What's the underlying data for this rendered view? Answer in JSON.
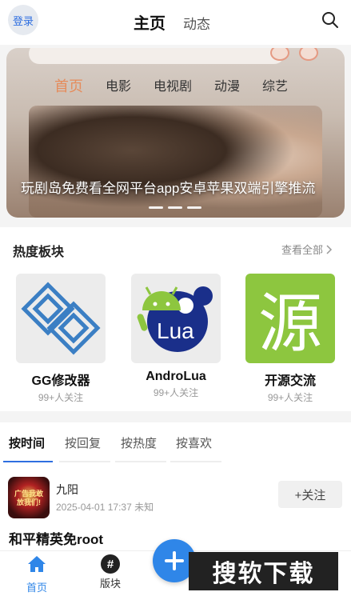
{
  "header": {
    "login_label": "登录",
    "tab_home": "主页",
    "tab_dynamic": "动态"
  },
  "banner": {
    "nav": [
      "首页",
      "电影",
      "电视剧",
      "动漫",
      "综艺"
    ],
    "title": "玩剧岛免费看全网平台app安卓苹果双端引擎推流"
  },
  "hot": {
    "title": "热度板块",
    "see_all": "查看全部",
    "boards": [
      {
        "name": "GG修改器",
        "follow": "99+人关注"
      },
      {
        "name": "AndroLua",
        "follow": "99+人关注"
      },
      {
        "name": "开源交流",
        "follow": "99+人关注"
      }
    ],
    "lua_text": "Lua",
    "source_char": "源"
  },
  "feed": {
    "tabs": [
      "按时间",
      "按回复",
      "按热度",
      "按喜欢"
    ],
    "post": {
      "avatar_text": "广告我敢放我们!",
      "user": "九阳",
      "meta": "2025-04-01 17:37 未知",
      "follow_label": "+关注",
      "title": "和平精英免root"
    }
  },
  "bottom_nav": {
    "home": "首页",
    "board": "版块",
    "board_icon_glyph": "#"
  },
  "watermark": "搜软下载",
  "colors": {
    "accent": "#2f86e8",
    "link": "#2f6fe0",
    "source_green": "#8dc63f"
  }
}
